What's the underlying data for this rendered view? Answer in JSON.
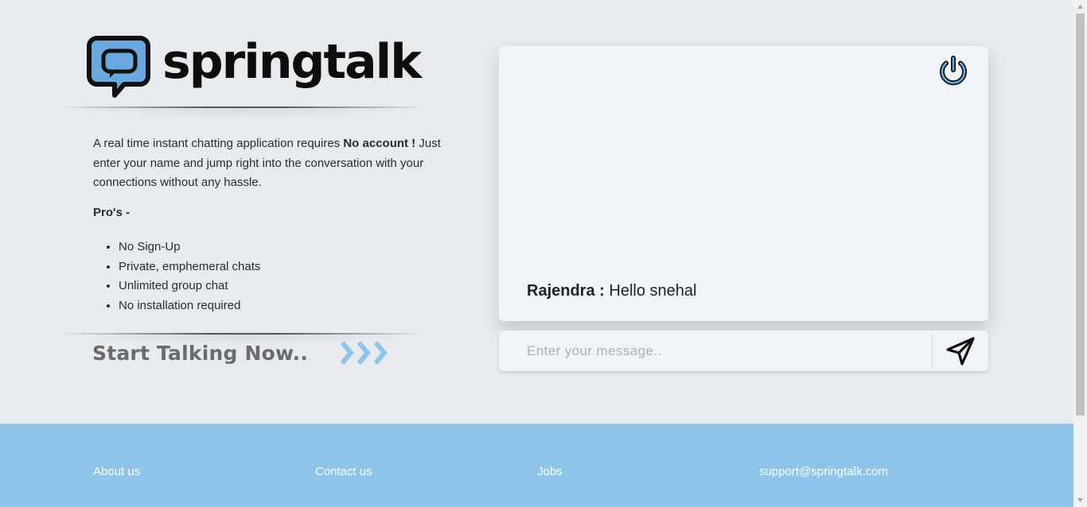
{
  "brand": {
    "name": "springtalk",
    "icon": "chat-bubble-logo-icon",
    "accent_color": "#8fc4ea"
  },
  "intro": {
    "text_before": "A real time instant chatting application requires ",
    "bold": "No account !",
    "text_after": " Just enter your name and jump right into the conversation with your connections without any hassle."
  },
  "pros": {
    "title": "Pro's -",
    "items": [
      "No Sign-Up",
      "Private, emphemeral chats",
      "Unlimited group chat",
      "No installation required"
    ]
  },
  "cta": {
    "label": "Start Talking Now..",
    "icon": "triple-chevron-right-icon"
  },
  "chat": {
    "power_icon": "power-icon",
    "messages": [
      {
        "sender": "Rajendra :",
        "text": "Hello snehal"
      }
    ],
    "input_placeholder": "Enter your message..",
    "send_icon": "send-icon"
  },
  "footer": {
    "links": [
      "About us",
      "Contact us",
      "Jobs",
      "support@springtalk.com"
    ]
  }
}
